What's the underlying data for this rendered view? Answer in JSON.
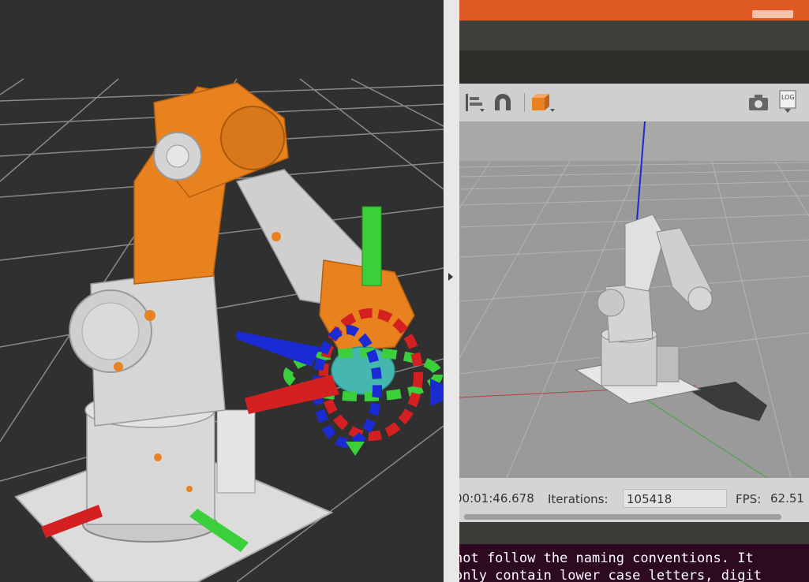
{
  "status": {
    "time_value": "00:01:46.678",
    "iterations_label": "Iterations:",
    "iterations_value": "105418",
    "fps_label": "FPS:",
    "fps_value": "62.51"
  },
  "toolbar": {
    "log_label": "LOG"
  },
  "terminal": {
    "lines": [
      "not follow the naming conventions. It",
      "only contain lower case letters, digit"
    ]
  },
  "colors": {
    "gazebo_topbar": "#e05a26",
    "robot_orange": "#e8821e",
    "axis_red": "#d42020",
    "axis_green": "#3ccf3c",
    "axis_blue": "#1a2bd4",
    "terminal_bg": "#2d0922"
  }
}
